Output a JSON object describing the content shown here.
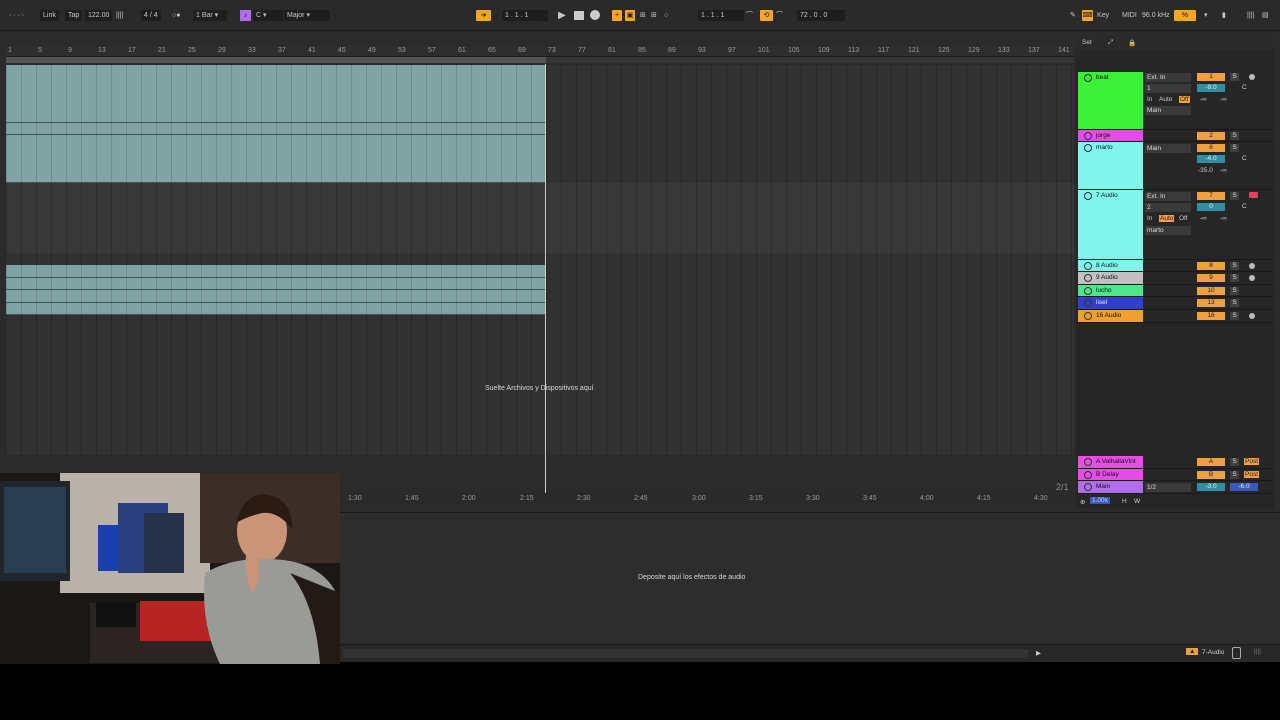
{
  "topbar": {
    "link": "Link",
    "tap": "Tap",
    "tempo": "122.00",
    "meter": "4 / 4",
    "quantize": "1 Bar",
    "key_root": "C",
    "scale": "Major",
    "position": "1 .  1 .  1",
    "loop_start": "1 .  1 .  1",
    "loop_length": "72 .  0 .  0",
    "key_label": "Key",
    "midi_label": "MIDI",
    "sample_rate": "96.0 kHz",
    "cpu": "%"
  },
  "ruler": {
    "bars": [
      "1",
      "5",
      "9",
      "13",
      "17",
      "21",
      "25",
      "29",
      "33",
      "37",
      "41",
      "45",
      "49",
      "53",
      "57",
      "61",
      "65",
      "69",
      "73",
      "77",
      "81",
      "85",
      "89",
      "93",
      "97",
      "101",
      "105",
      "109",
      "113",
      "117",
      "121",
      "125",
      "129",
      "133",
      "137",
      "141"
    ]
  },
  "arrangement": {
    "drop_hint": "Suelte Archivos y Dispositivos aquí",
    "set_label": "Set"
  },
  "tracks": [
    {
      "name": "beat",
      "color": "#3cf03a",
      "input": "Ext. In",
      "channel": "1",
      "monitor": [
        "In",
        "Auto",
        "Off"
      ],
      "output": "Main",
      "number": "1",
      "volume": "-9.0",
      "pan": "C",
      "sends": [
        "-∞",
        "-∞"
      ],
      "solo": "S"
    },
    {
      "name": "jorge",
      "color": "#e64de6",
      "number": "2",
      "solo": "S"
    },
    {
      "name": "marto",
      "color": "#7ff5ee",
      "output": "Main",
      "number": "6",
      "volume": "-4.0",
      "pan": "C",
      "sends": [
        "-35.0",
        "-∞"
      ],
      "solo": "S"
    },
    {
      "name": "7 Audio",
      "color": "#7ff5ee",
      "input": "Ext. In",
      "channel": "2",
      "monitor": [
        "In",
        "Auto",
        "Off"
      ],
      "output": "marto",
      "number": "7",
      "volume": "0",
      "pan": "C",
      "sends": [
        "-∞",
        "-∞"
      ],
      "solo": "S"
    },
    {
      "name": "8 Audio",
      "color": "#7ff5ee",
      "number": "8",
      "solo": "S"
    },
    {
      "name": "9 Audio",
      "color": "#c0c0c0",
      "number": "9",
      "solo": "S"
    },
    {
      "name": "lucho",
      "color": "#4de68a",
      "number": "10",
      "solo": "S"
    },
    {
      "name": "lisel",
      "color": "#2f3fd0",
      "number": "13",
      "solo": "S"
    },
    {
      "name": "16 Audio",
      "color": "#f0a030",
      "number": "16",
      "solo": "S"
    }
  ],
  "returns": [
    {
      "name": "A ValhallaVint",
      "color": "#e64de6",
      "letter": "A",
      "post": "Post",
      "solo": "S"
    },
    {
      "name": "B Delay",
      "color": "#e64de6",
      "letter": "B",
      "post": "Post",
      "solo": "S"
    },
    {
      "name": "Main",
      "color": "#b06ee8",
      "output": "1/2",
      "volume": "-3.0",
      "pan": "-6.0"
    }
  ],
  "bottom": {
    "times": [
      "1:30",
      "1:45",
      "2:00",
      "2:15",
      "2:30",
      "2:45",
      "3:00",
      "3:15",
      "3:30",
      "3:45",
      "4:00",
      "4:15",
      "4:30"
    ],
    "zoom": "1.00x",
    "h": "H",
    "w": "W",
    "page": "2/1"
  },
  "device": {
    "drop_hint": "Deposite aquí los efectos de audio",
    "selected_track": "7-Audio"
  }
}
